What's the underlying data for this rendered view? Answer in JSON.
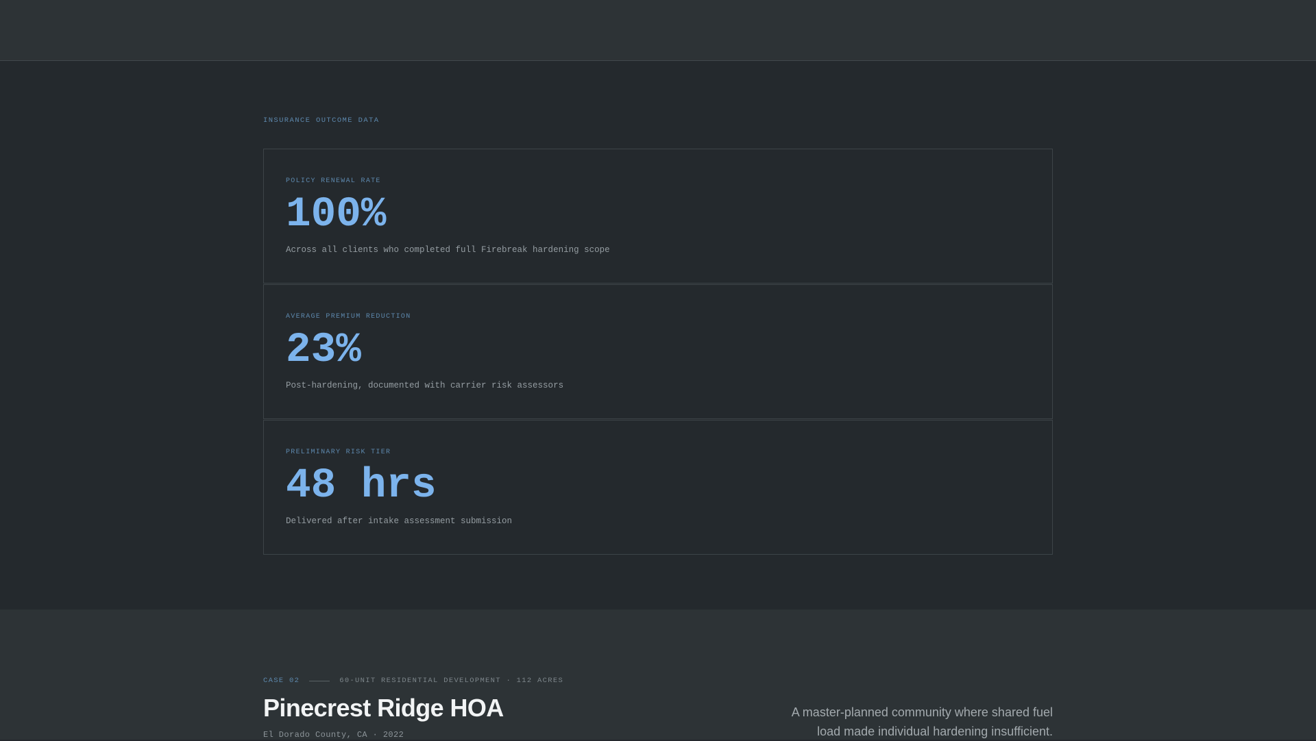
{
  "outcomes": {
    "eyebrow": "INSURANCE OUTCOME DATA",
    "cards": [
      {
        "label": "POLICY RENEWAL RATE",
        "value": "100%",
        "desc": "Across all clients who completed full Firebreak hardening scope"
      },
      {
        "label": "AVERAGE PREMIUM REDUCTION",
        "value": "23%",
        "desc": "Post-hardening, documented with carrier risk assessors"
      },
      {
        "label": "PRELIMINARY RISK TIER",
        "value": "48 hrs",
        "desc": "Delivered after intake assessment submission"
      }
    ]
  },
  "case": {
    "number": "CASE 02",
    "descriptor": "60-UNIT RESIDENTIAL DEVELOPMENT · 112 ACRES",
    "title": "Pinecrest Ridge HOA",
    "subtitle": "El Dorado County, CA · 2022",
    "blurb": "A master-planned community where shared fuel load made individual hardening insufficient."
  },
  "colors": {
    "accent": "#7cb3ec",
    "label": "#5d88ad",
    "background": "#24292d",
    "band": "#2d3336"
  }
}
